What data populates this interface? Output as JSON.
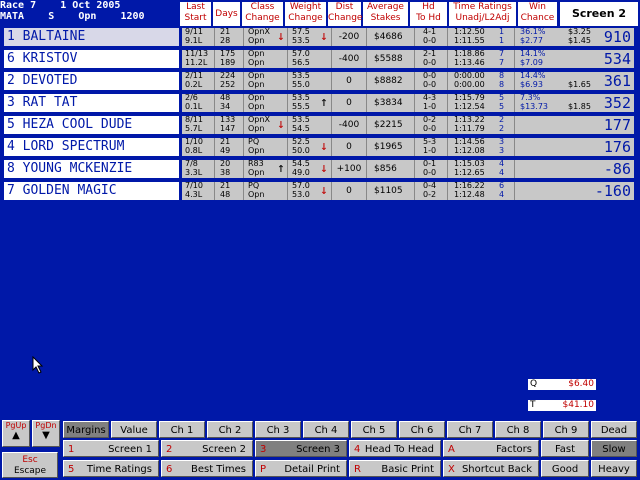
{
  "race": {
    "line1_left": "Race 7",
    "line1_right": "1 Oct 2005",
    "line2_left": "MATA",
    "line2_mid": "S",
    "line2_opn": "Opn",
    "line2_dist": "1200"
  },
  "headers": [
    {
      "l1": "Last",
      "l2": "Start"
    },
    {
      "l1": "Days",
      "l2": ""
    },
    {
      "l1": "Class",
      "l2": "Change"
    },
    {
      "l1": "Weight",
      "l2": "Change"
    },
    {
      "l1": "Dist",
      "l2": "Change"
    },
    {
      "l1": "Average",
      "l2": "Stakes"
    },
    {
      "l1": "Hd",
      "l2": "To Hd"
    },
    {
      "l1": "Time Ratings",
      "l2": "Unadj/L2Adj"
    },
    {
      "l1": "Win",
      "l2": "Chance"
    }
  ],
  "screen_label": "Screen 2",
  "runners": [
    {
      "name": "1 BALTAINE",
      "ls1": "9/11",
      "ls2": "9.1L",
      "d1": "21",
      "d2": "28",
      "c1": "OpnX",
      "c2": "Opn",
      "ca": "down",
      "w1": "57.5",
      "w2": "53.5",
      "wa": "down",
      "dist": "-200",
      "stakes": "$4686",
      "h1": "4-1",
      "h2": "0-0",
      "t1": "1:12.50",
      "t2": "1:11.55",
      "tn1": "1",
      "tn2": "1",
      "wc1": "36.1%",
      "wc2": "$2.77",
      "pr1": "$3.25",
      "pr2": "$1.45",
      "rating": "910"
    },
    {
      "name": "6 KRISTOV",
      "ls1": "11/13",
      "ls2": "11.2L",
      "d1": "175",
      "d2": "189",
      "c1": "Opn",
      "c2": "Opn",
      "ca": "",
      "w1": "57.0",
      "w2": "56.5",
      "wa": "",
      "dist": "-400",
      "stakes": "$5588",
      "h1": "2-1",
      "h2": "0-0",
      "t1": "1:18.86",
      "t2": "1:13.46",
      "tn1": "7",
      "tn2": "7",
      "wc1": "14.1%",
      "wc2": "$7.09",
      "pr1": "",
      "pr2": "",
      "rating": "534"
    },
    {
      "name": "2 DEVOTED",
      "ls1": "2/11",
      "ls2": "0.2L",
      "d1": "224",
      "d2": "252",
      "c1": "Opn",
      "c2": "Opn",
      "ca": "",
      "w1": "53.5",
      "w2": "55.0",
      "wa": "",
      "dist": "0",
      "stakes": "$8882",
      "h1": "0-0",
      "h2": "0-0",
      "t1": "0:00.00",
      "t2": "0:00.00",
      "tn1": "8",
      "tn2": "8",
      "wc1": "14.4%",
      "wc2": "$6.93",
      "pr1": "",
      "pr2": "$1.65",
      "rating": "361"
    },
    {
      "name": "3 RAT TAT",
      "ls1": "2/6",
      "ls2": "0.1L",
      "d1": "48",
      "d2": "34",
      "c1": "Opn",
      "c2": "Opn",
      "ca": "",
      "w1": "53.5",
      "w2": "55.5",
      "wa": "up",
      "dist": "0",
      "stakes": "$3834",
      "h1": "4-3",
      "h2": "1-0",
      "t1": "1:15.79",
      "t2": "1:12.54",
      "tn1": "5",
      "tn2": "5",
      "wc1": "7.3%",
      "wc2": "$13.73",
      "pr1": "",
      "pr2": "$1.85",
      "rating": "352"
    },
    {
      "name": "5 HEZA COOL DUDE",
      "ls1": "8/11",
      "ls2": "5.7L",
      "d1": "133",
      "d2": "147",
      "c1": "OpnX",
      "c2": "Opn",
      "ca": "down",
      "w1": "53.5",
      "w2": "54.5",
      "wa": "",
      "dist": "-400",
      "stakes": "$2215",
      "h1": "0-2",
      "h2": "0-0",
      "t1": "1:13.22",
      "t2": "1:11.79",
      "tn1": "2",
      "tn2": "2",
      "wc1": "",
      "wc2": "",
      "pr1": "",
      "pr2": "",
      "rating": "177"
    },
    {
      "name": "4 LORD SPECTRUM",
      "ls1": "1/10",
      "ls2": "0.8L",
      "d1": "21",
      "d2": "49",
      "c1": "PQ",
      "c2": "Opn",
      "ca": "",
      "w1": "52.5",
      "w2": "50.0",
      "wa": "down",
      "dist": "0",
      "stakes": "$1965",
      "h1": "5-3",
      "h2": "1-0",
      "t1": "1:14.56",
      "t2": "1:12.08",
      "tn1": "3",
      "tn2": "3",
      "wc1": "",
      "wc2": "",
      "pr1": "",
      "pr2": "",
      "rating": "176"
    },
    {
      "name": "8 YOUNG MCKENZIE",
      "ls1": "7/8",
      "ls2": "3.3L",
      "d1": "20",
      "d2": "38",
      "c1": "R83",
      "c2": "Opn",
      "ca": "up",
      "w1": "54.5",
      "w2": "49.0",
      "wa": "down",
      "dist": "+100",
      "stakes": "$856",
      "h1": "0-1",
      "h2": "0-0",
      "t1": "1:15.03",
      "t2": "1:12.65",
      "tn1": "4",
      "tn2": "4",
      "wc1": "",
      "wc2": "",
      "pr1": "",
      "pr2": "",
      "rating": "-86"
    },
    {
      "name": "7 GOLDEN MAGIC",
      "ls1": "7/10",
      "ls2": "4.3L",
      "d1": "21",
      "d2": "48",
      "c1": "PQ",
      "c2": "Opn",
      "ca": "",
      "w1": "57.0",
      "w2": "53.0",
      "wa": "down",
      "dist": "0",
      "stakes": "$1105",
      "h1": "0-4",
      "h2": "0-2",
      "t1": "1:16.22",
      "t2": "1:12.48",
      "tn1": "6",
      "tn2": "4",
      "wc1": "",
      "wc2": "",
      "pr1": "",
      "pr2": "",
      "rating": "-160"
    }
  ],
  "pools": [
    {
      "key": "Q",
      "value": "$6.40"
    },
    {
      "key": "T",
      "value": "$41.10"
    }
  ],
  "nav": {
    "pgup": "PgUp",
    "pgdn": "PgDn",
    "esc_key": "Esc",
    "esc_label": "Escape"
  },
  "row1": [
    "Margins",
    "Value",
    "Ch 1",
    "Ch 2",
    "Ch 3",
    "Ch 4",
    "Ch 5",
    "Ch 6",
    "Ch 7",
    "Ch 8",
    "Ch 9",
    "Dead"
  ],
  "row2": [
    {
      "num": "1",
      "label": "Screen 1"
    },
    {
      "num": "2",
      "label": "Screen 2"
    },
    {
      "num": "3",
      "label": "Screen 3"
    },
    {
      "num": "4",
      "label": "Head To Head"
    },
    {
      "num": "A",
      "label": "Factors"
    },
    {
      "num": "",
      "label": "Fast"
    },
    {
      "num": "",
      "label": "Slow"
    }
  ],
  "row3": [
    {
      "num": "5",
      "label": "Time Ratings"
    },
    {
      "num": "6",
      "label": "Best Times"
    },
    {
      "num": "P",
      "label": "Detail Print"
    },
    {
      "num": "R",
      "label": "Basic Print"
    },
    {
      "num": "X",
      "label": "Shortcut Back"
    },
    {
      "num": "",
      "label": "Good"
    },
    {
      "num": "",
      "label": "Heavy"
    }
  ]
}
